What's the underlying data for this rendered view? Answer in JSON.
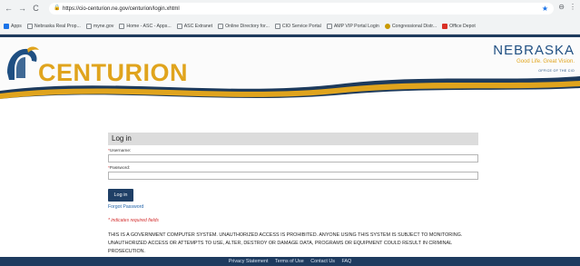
{
  "browser": {
    "nav_back": "←",
    "nav_forward": "→",
    "nav_reload": "C",
    "lock": "🔒",
    "url": "https://cio-centurion.ne.gov/centurion/login.xhtml",
    "star": "★",
    "account": "⊖",
    "menu": "⋮",
    "bookmarks": [
      {
        "label": "Apps",
        "icon": "grid"
      },
      {
        "label": "Nebraska Real Prop...",
        "icon": "doc"
      },
      {
        "label": "myne.gov",
        "icon": "doc"
      },
      {
        "label": "Home - ASC - Apps...",
        "icon": "doc"
      },
      {
        "label": "ASC Extranet",
        "icon": "doc"
      },
      {
        "label": "Online Directory for...",
        "icon": "doc"
      },
      {
        "label": "CIO Service Portal",
        "icon": "doc"
      },
      {
        "label": "AMP VIP Portal Login",
        "icon": "doc"
      },
      {
        "label": "Congressional Distr...",
        "icon": "gold"
      },
      {
        "label": "Office Depot",
        "icon": "red"
      }
    ]
  },
  "header": {
    "brand": "CENTURION",
    "state": "NEBRASKA",
    "tagline": "Good Life. Great Vision.",
    "office": "OFFICE OF THE CIO"
  },
  "login": {
    "title": "Log in",
    "username_label": "Username:",
    "password_label": "Password:",
    "required_mark": "*",
    "button": "Log in",
    "forgot": "Forgot Password",
    "required_note": "* indicates required fields",
    "warning": "THIS IS A GOVERNMENT COMPUTER SYSTEM. UNAUTHORIZED ACCESS IS PROHIBITED. ANYONE USING THIS SYSTEM IS SUBJECT TO MONITORING. UNAUTHORIZED ACCESS OR ATTEMPTS TO USE, ALTER, DESTROY OR DAMAGE DATA, PROGRAMS OR EQUIPMENT COULD RESULT IN CRIMINAL PROSECUTION."
  },
  "footer": {
    "links": [
      "Privacy Statement",
      "Terms of Use",
      "Contact Us",
      "FAQ"
    ]
  },
  "colors": {
    "brand_gold": "#e0a41d",
    "nebraska_blue": "#1f4f82",
    "footer_navy": "#1e3b5f",
    "button_navy": "#1f3f66",
    "required_red": "#d32f2f"
  }
}
